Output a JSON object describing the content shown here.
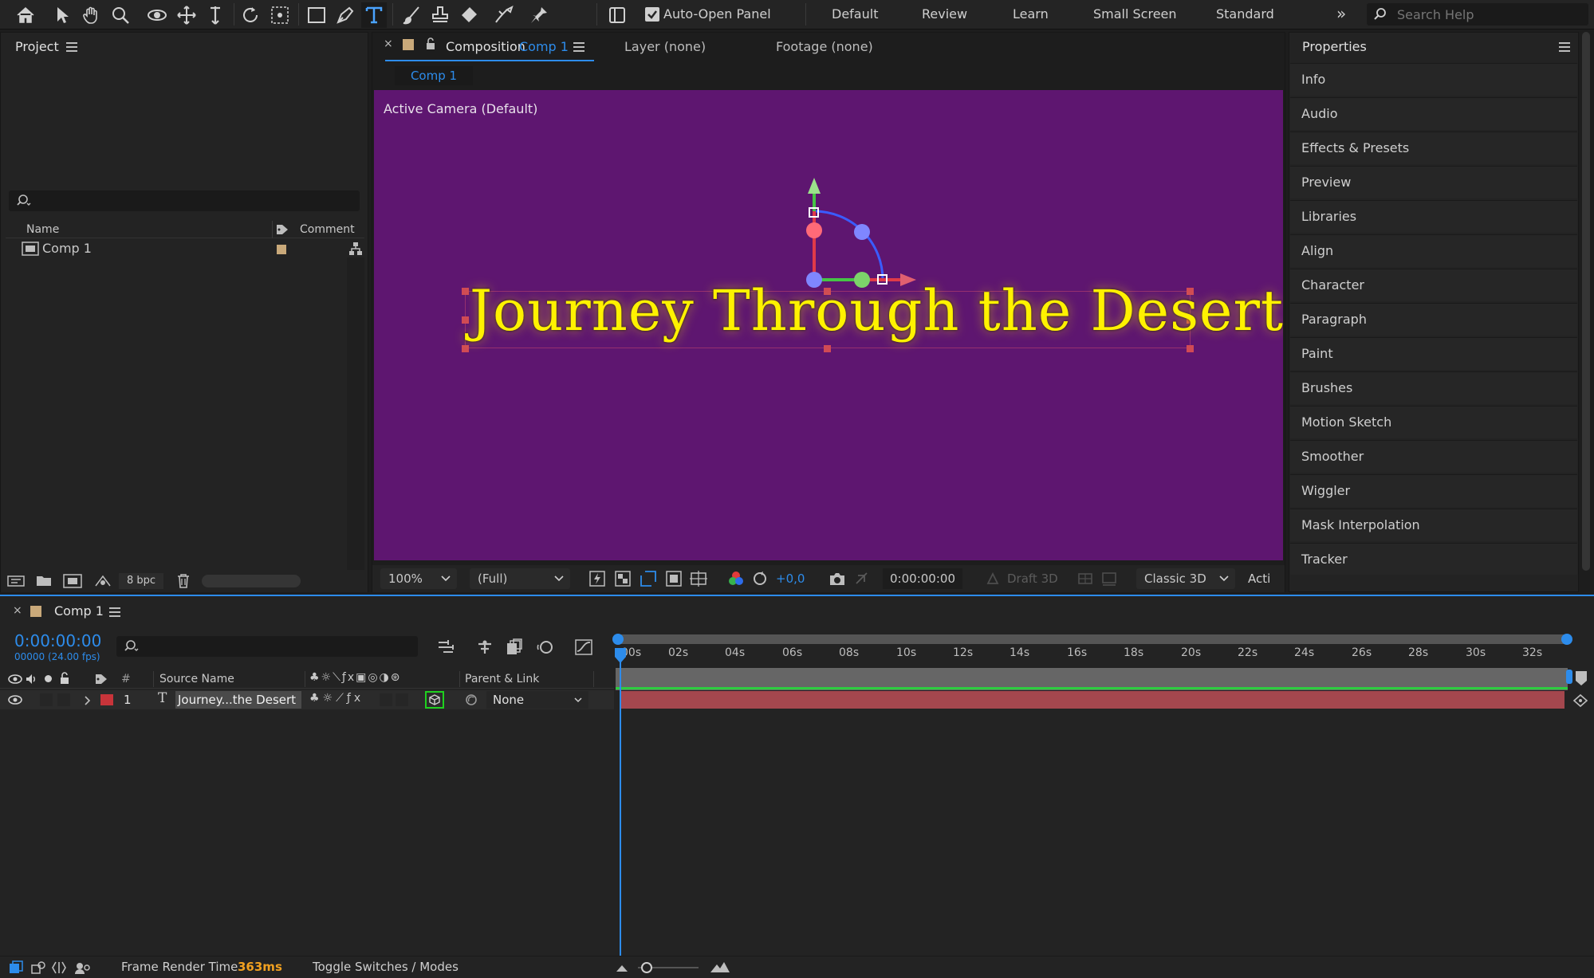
{
  "toolbar": {
    "auto_open_panel": "Auto-Open Panel",
    "workspaces": [
      "Default",
      "Review",
      "Learn",
      "Small Screen",
      "Standard"
    ],
    "search_placeholder": "Search Help"
  },
  "project": {
    "title": "Project",
    "col_name": "Name",
    "col_comment": "Comment",
    "item_name": "Comp 1",
    "bpc": "8 bpc"
  },
  "composition": {
    "tab_prefix": "Composition",
    "tab_name": "Comp 1",
    "layer_tab": "Layer (none)",
    "footage_tab": "Footage (none)",
    "subtab": "Comp 1",
    "camera_label": "Active Camera (Default)",
    "text": "Journey Through the Desert",
    "zoom": "100%",
    "resolution": "(Full)",
    "exposure": "+0,0",
    "timecode": "0:00:00:00",
    "draft3d": "Draft 3D",
    "renderer": "Classic 3D",
    "active_camera_short": "Acti"
  },
  "properties": {
    "title": "Properties",
    "items": [
      "Info",
      "Audio",
      "Effects & Presets",
      "Preview",
      "Libraries",
      "Align",
      "Character",
      "Paragraph",
      "Paint",
      "Brushes",
      "Motion Sketch",
      "Smoother",
      "Wiggler",
      "Mask Interpolation",
      "Tracker"
    ]
  },
  "timeline": {
    "comp_name": "Comp 1",
    "timecode": "0:00:00:00",
    "frame_info": "00000 (24.00 fps)",
    "col_hash": "#",
    "col_source_name": "Source Name",
    "col_parent": "Parent & Link",
    "layer_number": "1",
    "layer_name": "Journey...the Desert",
    "parent_value": "None",
    "ruler_labels": [
      "00s",
      "02s",
      "04s",
      "06s",
      "08s",
      "10s",
      "12s",
      "14s",
      "16s",
      "18s",
      "20s",
      "22s",
      "24s",
      "26s",
      "28s",
      "30s",
      "32s"
    ],
    "frame_render_label": "Frame Render Time",
    "frame_render_value": "363ms",
    "toggle_label": "Toggle Switches / Modes"
  },
  "colors": {
    "accent_blue": "#2d8ceb",
    "comp_bg": "#5e1670",
    "text_yellow": "#fff200",
    "layer_bar": "#a4474e",
    "label_red": "#c8343a",
    "label_tan": "#c9a97a",
    "render_orange": "#f0a020"
  }
}
